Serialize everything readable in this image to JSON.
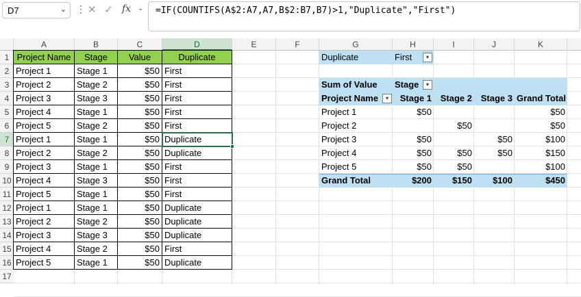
{
  "formula_bar": {
    "name_box": "D7",
    "formula": "=IF(COUNTIFS(A$2:A7,A7,B$2:B7,B7)>1,\"Duplicate\",\"First\")",
    "icons": [
      "cancel-icon",
      "enter-icon",
      "fx-icon"
    ]
  },
  "columns": [
    "A",
    "B",
    "C",
    "D",
    "E",
    "F",
    "G",
    "H",
    "I",
    "J",
    "K"
  ],
  "rows": [
    "1",
    "2",
    "3",
    "4",
    "5",
    "6",
    "7",
    "8",
    "9",
    "10",
    "11",
    "12",
    "13",
    "14",
    "15",
    "16",
    "17"
  ],
  "table": {
    "headers": [
      "Project Name",
      "Stage",
      "Value",
      "Duplicate"
    ],
    "rows": [
      [
        "Project 1",
        "Stage 1",
        "$50",
        "First"
      ],
      [
        "Project 2",
        "Stage 2",
        "$50",
        "First"
      ],
      [
        "Project 3",
        "Stage 3",
        "$50",
        "First"
      ],
      [
        "Project 4",
        "Stage 1",
        "$50",
        "First"
      ],
      [
        "Project 5",
        "Stage 2",
        "$50",
        "First"
      ],
      [
        "Project 1",
        "Stage 1",
        "$50",
        "Duplicate"
      ],
      [
        "Project 2",
        "Stage 2",
        "$50",
        "Duplicate"
      ],
      [
        "Project 3",
        "Stage 1",
        "$50",
        "First"
      ],
      [
        "Project 4",
        "Stage 3",
        "$50",
        "First"
      ],
      [
        "Project 5",
        "Stage 1",
        "$50",
        "First"
      ],
      [
        "Project 1",
        "Stage 1",
        "$50",
        "Duplicate"
      ],
      [
        "Project 2",
        "Stage 2",
        "$50",
        "Duplicate"
      ],
      [
        "Project 3",
        "Stage 3",
        "$50",
        "Duplicate"
      ],
      [
        "Project 4",
        "Stage 2",
        "$50",
        "First"
      ],
      [
        "Project 5",
        "Stage 1",
        "$50",
        "Duplicate"
      ]
    ]
  },
  "pivot": {
    "filter_label": "Duplicate",
    "filter_value": "First",
    "sum_label": "Sum of Value",
    "col_field_label": "Stage",
    "row_field_label": "Project Name",
    "col_headers": [
      "Stage 1",
      "Stage 2",
      "Stage 3",
      "Grand Total"
    ],
    "rows": [
      {
        "name": "Project 1",
        "values": [
          "$50",
          "",
          "",
          "$50"
        ]
      },
      {
        "name": "Project 2",
        "values": [
          "",
          "$50",
          "",
          "$50"
        ]
      },
      {
        "name": "Project 3",
        "values": [
          "$50",
          "",
          "$50",
          "$100"
        ]
      },
      {
        "name": "Project 4",
        "values": [
          "$50",
          "$50",
          "$50",
          "$150"
        ]
      },
      {
        "name": "Project 5",
        "values": [
          "$50",
          "$50",
          "",
          "$100"
        ]
      }
    ],
    "total": {
      "name": "Grand Total",
      "values": [
        "$200",
        "$150",
        "$100",
        "$450"
      ]
    }
  },
  "colors": {
    "header_green": "#92d050",
    "pivot_blue": "#bde0f2",
    "selection": "#217346"
  }
}
